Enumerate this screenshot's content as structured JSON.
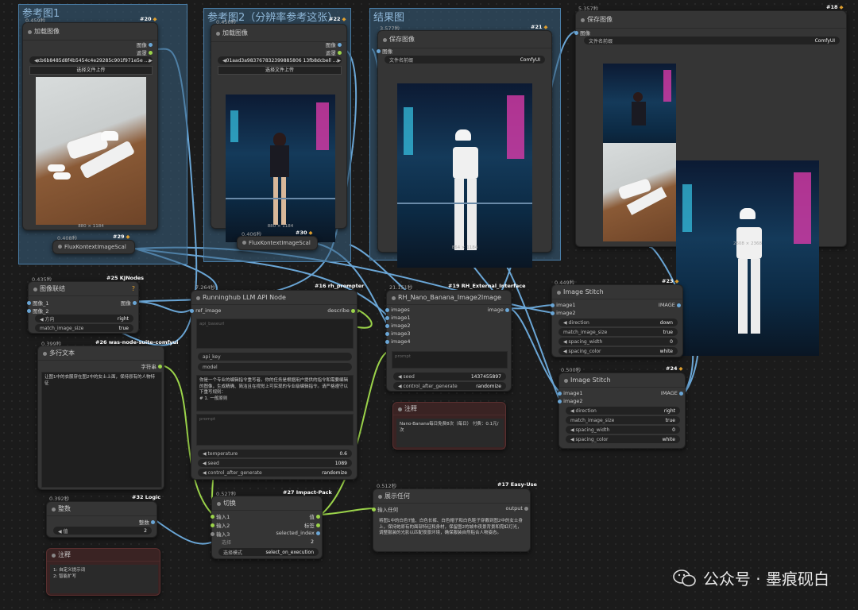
{
  "groups": [
    {
      "id": "g1",
      "title": "参考图1"
    },
    {
      "id": "g2",
      "title": "参考图2（分辨率参考这张）"
    },
    {
      "id": "g3",
      "title": "结果图"
    }
  ],
  "nodes": {
    "n20": {
      "time": "0.459秒",
      "id": "#20",
      "title": "加载图像",
      "out1": "图像",
      "out2": "遮罩",
      "file": "cb6b8485d8f4b5454c4e29285c901f971e5e ...",
      "upload": "选择文件上传",
      "cap": "880 × 1184"
    },
    "n22": {
      "time": "0.450秒",
      "id": "#22",
      "title": "加载图像",
      "out1": "图像",
      "out2": "遮罩",
      "file": "01aad3a983767832399885806 13fb8dcbell ...",
      "upload": "选择文件上传",
      "cap": "880 × 1184"
    },
    "n21": {
      "time": "3.577秒",
      "id": "#21",
      "title": "保存图像",
      "in1": "图像",
      "prefix_label": "文件名前缀",
      "prefix_val": "ComfyUI",
      "cap": "864 × 1184"
    },
    "n18": {
      "time": "5.357秒",
      "id": "#18",
      "title": "保存图像",
      "in1": "图像",
      "prefix_label": "文件名前缀",
      "prefix_val": "ComfyUI",
      "cap": "2608 × 2368"
    },
    "n29": {
      "time": "0.408秒",
      "id": "#29",
      "title": "FluxKontextImageScal"
    },
    "n30": {
      "time": "0.406秒",
      "id": "#30",
      "title": "FluxKontextImageScal"
    },
    "n25": {
      "time": "0.435秒",
      "id": "#25 KJNodes",
      "title": "图像联结",
      "in1": "图像_1",
      "in2": "图像_2",
      "out1": "图像",
      "w1_label": "方向",
      "w1_val": "right",
      "w2_label": "match_image_size",
      "w2_val": "true"
    },
    "n26": {
      "time": "0.399秒",
      "id": "#26 was-node-suite-comfyui",
      "title": "多行文本",
      "out1": "字符串",
      "text": "让图1中的衣服穿在图2中的女士上面，保持原有的人物特征"
    },
    "n16": {
      "time": "7.264秒",
      "id": "#16 rh_prompter",
      "title": "Runninghub LLM API Node",
      "in1": "ref_image",
      "out1": "describe",
      "ph1": "api_baseurl",
      "w_api_key": "api_key",
      "w_model": "model",
      "text": "你是一个专业的编辑指令重写者。你的任务是根据用户提供的指令和需要编辑的图像，生成精确、简洁且在视觉上可实现的专业级编辑指令。请严格遵守以下重写规则：\n# 1. 一般原则",
      "ph2": "prompt",
      "w_temp_label": "temperature",
      "w_temp_val": "0.6",
      "w_seed_label": "seed",
      "w_seed_val": "1089",
      "w_cag_label": "control_after_generate",
      "w_cag_val": "randomize"
    },
    "n19": {
      "time": "21.151秒",
      "id": "#19 RH_External_Interface",
      "title": "RH_Nano_Banana_Image2Image",
      "in1": "images",
      "in2": "image1",
      "in3": "image2",
      "in4": "image3",
      "in5": "image4",
      "out1": "image",
      "ph1": "prompt",
      "w_seed_label": "seed",
      "w_seed_val": "1437455897",
      "w_cag_label": "control_after_generate",
      "w_cag_val": "randomize"
    },
    "n23": {
      "time": "0.449秒",
      "id": "#23",
      "title": "Image Stitch",
      "in1": "image1",
      "in2": "image2",
      "out1": "IMAGE",
      "w1_label": "direction",
      "w1_val": "down",
      "w2_label": "match_image_size",
      "w2_val": "true",
      "w3_label": "spacing_width",
      "w3_val": "0",
      "w4_label": "spacing_color",
      "w4_val": "white"
    },
    "n24": {
      "time": "0.500秒",
      "id": "#24",
      "title": "Image Stitch",
      "in1": "image1",
      "in2": "image2",
      "out1": "IMAGE",
      "w1_label": "direction",
      "w1_val": "right",
      "w2_label": "match_image_size",
      "w2_val": "true",
      "w3_label": "spacing_width",
      "w3_val": "0",
      "w4_label": "spacing_color",
      "w4_val": "white"
    },
    "note1": {
      "title": "注释",
      "text": "Nano-Banana每日免费8次（每日）  付费：0.1元/次"
    },
    "n32": {
      "time": "0.392秒",
      "id": "#32 Logic",
      "title": "整数",
      "out1": "整数",
      "w1_label": "值",
      "w1_val": "2"
    },
    "n27": {
      "time": "0.527秒",
      "id": "#27 Impact-Pack",
      "title": "切换",
      "in1": "输入1",
      "in2": "输入2",
      "in3": "输入3",
      "in4": "选择",
      "out1": "值",
      "out2": "标签",
      "out3": "selected_index",
      "sel_val": "2",
      "mode_label": "选择模式",
      "mode_val": "select_on_execution"
    },
    "n17": {
      "time": "0.512秒",
      "id": "#17 Easy-Use",
      "title": "展示任何",
      "in1": "输入任何",
      "out1": "output",
      "text": "将图1中的白色T恤、白色长裤、白色帽子和白色鞋子穿戴到图2中的女士身上，保持她原有的面部特征和身材，保留图2的城市夜景背景和霓虹灯光，调整服装的光影以匹配夜景环境，确保服装自然贴合人物姿态。"
    },
    "note2": {
      "title": "注释",
      "text": "1: 自定义提示词\n2: 智能扩写"
    }
  },
  "watermark": "公众号 · 墨痕砚白"
}
